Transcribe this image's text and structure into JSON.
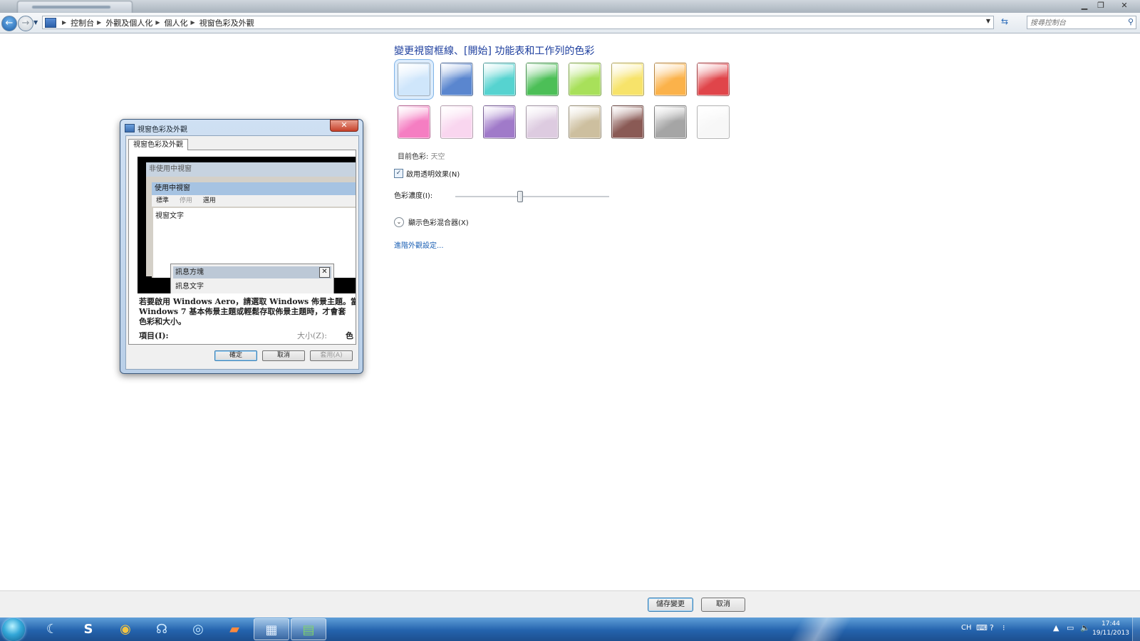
{
  "breadcrumb": [
    "控制台",
    "外觀及個人化",
    "個人化",
    "視窗色彩及外觀"
  ],
  "search": {
    "placeholder": "搜尋控制台"
  },
  "main": {
    "heading": "變更視窗框線、[開始] 功能表和工作列的色彩",
    "current_color_label": "目前色彩:",
    "current_color_value": "天空",
    "transparency_label": "啟用透明效果(N)",
    "transparency_checked": true,
    "intensity_label": "色彩濃度(I):",
    "intensity_level": 0.42,
    "mixer_label": "顯示色彩混合器(X)",
    "advanced_link": "進階外觀設定..."
  },
  "swatches": [
    {
      "color": "#cfe6fb",
      "selected": true
    },
    {
      "color": "#5a86cf"
    },
    {
      "color": "#56d3d0"
    },
    {
      "color": "#4cbf57"
    },
    {
      "color": "#a8e05a"
    },
    {
      "color": "#f7e36a"
    },
    {
      "color": "#fbb24a"
    },
    {
      "color": "#e0454a"
    },
    {
      "color": "#f57ec2"
    },
    {
      "color": "#f9d6ef"
    },
    {
      "color": "#a07ac9"
    },
    {
      "color": "#ddcbe0"
    },
    {
      "color": "#cdbf9f"
    },
    {
      "color": "#8a5a55"
    },
    {
      "color": "#a5a5a5"
    },
    {
      "color": "#f7f7f7"
    }
  ],
  "dialog": {
    "title": "視窗色彩及外觀",
    "tab": "視窗色彩及外觀",
    "inactive_window": "非使用中視窗",
    "active_window": "使用中視窗",
    "menu_normal": "標準",
    "menu_disabled": "停用",
    "menu_selected": "選用",
    "window_text": "視窗文字",
    "msgbox_title": "訊息方塊",
    "msgbox_text": "訊息文字",
    "msgbox_ok": "確定",
    "note_line1": "若要啟用 Windows Aero，請選取 Windows 佈景主題。當",
    "note_line2": "Windows 7 基本佈景主題或輕鬆存取佈景主題時，才會套",
    "note_line3": "色彩和大小。",
    "item_label": "項目(I):",
    "size_label": "大小(Z):",
    "color_label": "色",
    "ok": "確定",
    "cancel": "取消",
    "apply": "套用(A)"
  },
  "footer": {
    "save": "儲存變更",
    "cancel": "取消"
  },
  "taskbar": {
    "lang": "CH",
    "time": "17:44",
    "date": "19/11/2013"
  }
}
